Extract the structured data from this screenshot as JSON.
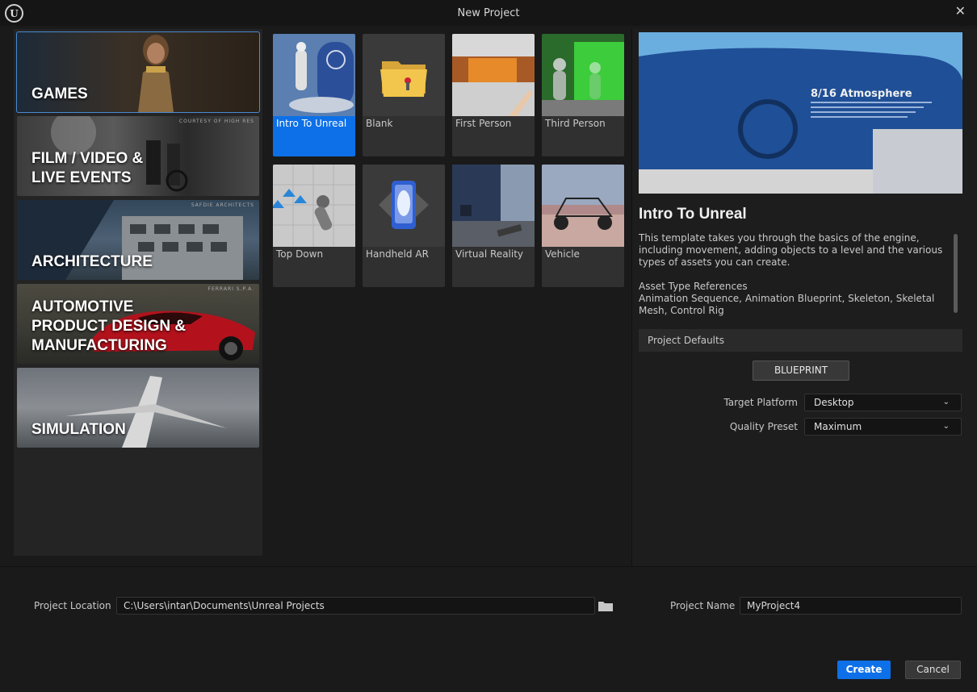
{
  "window": {
    "title": "New Project",
    "logo_glyph": "U",
    "close_glyph": "✕"
  },
  "categories": [
    {
      "label": "GAMES",
      "credit": "",
      "selected": true
    },
    {
      "label": "FILM / VIDEO &\nLIVE EVENTS",
      "credit": "COURTESY OF HIGH RES",
      "selected": false
    },
    {
      "label": "ARCHITECTURE",
      "credit": "SAFDIE ARCHITECTS",
      "selected": false
    },
    {
      "label": "AUTOMOTIVE\nPRODUCT DESIGN &\nMANUFACTURING",
      "credit": "FERRARI S.P.A.",
      "selected": false
    },
    {
      "label": "SIMULATION",
      "credit": "",
      "selected": false
    }
  ],
  "templates": [
    {
      "label": "Intro To Unreal",
      "selected": true
    },
    {
      "label": "Blank",
      "selected": false
    },
    {
      "label": "First Person",
      "selected": false
    },
    {
      "label": "Third Person",
      "selected": false
    },
    {
      "label": "Top Down",
      "selected": false
    },
    {
      "label": "Handheld AR",
      "selected": false
    },
    {
      "label": "Virtual Reality",
      "selected": false
    },
    {
      "label": "Vehicle",
      "selected": false
    }
  ],
  "details": {
    "preview_heading": "8/16 Atmosphere",
    "title": "Intro To Unreal",
    "description": "This template takes you through the basics of the engine, including movement, adding objects to a level and the various types of assets you can create.",
    "asset_refs_heading": "Asset Type References",
    "asset_refs": "Animation Sequence, Animation Blueprint, Skeleton, Skeletal Mesh, Control Rig",
    "defaults_header": "Project Defaults",
    "blueprint_label": "BLUEPRINT",
    "target_platform_label": "Target Platform",
    "target_platform_value": "Desktop",
    "quality_preset_label": "Quality Preset",
    "quality_preset_value": "Maximum",
    "chevron_glyph": "⌄"
  },
  "footer": {
    "location_label": "Project Location",
    "location_value": "C:\\Users\\intar\\Documents\\Unreal Projects",
    "name_label": "Project Name",
    "name_value": "MyProject4",
    "create_label": "Create",
    "cancel_label": "Cancel"
  },
  "colors": {
    "accent": "#0d70e8",
    "panel": "#242424",
    "tile": "#303030"
  }
}
